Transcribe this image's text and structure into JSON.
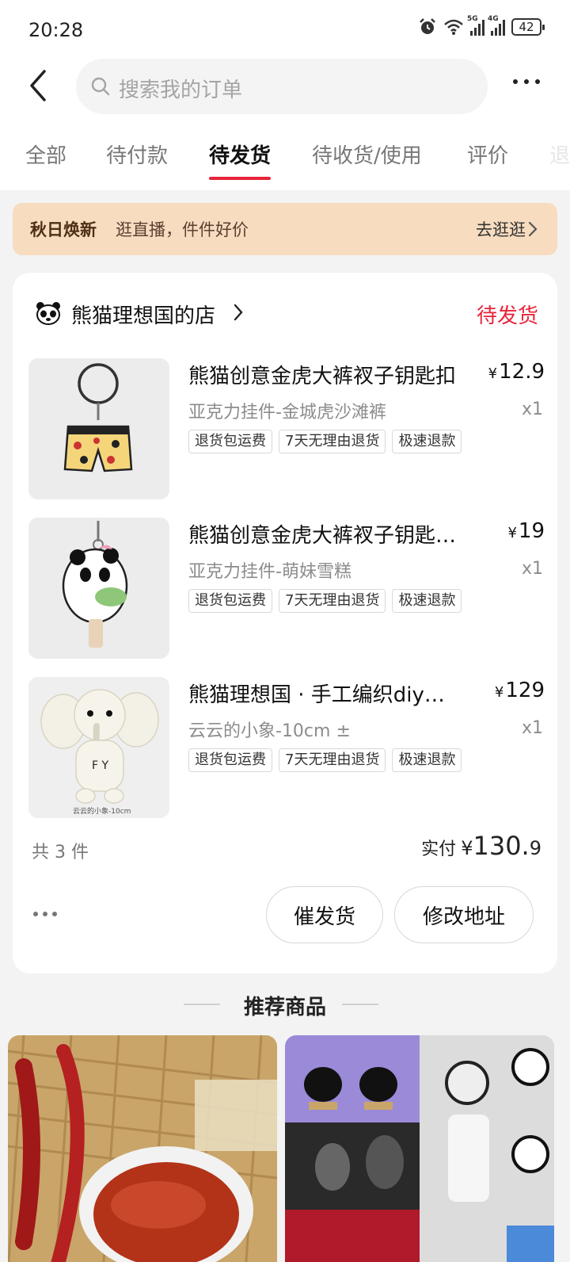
{
  "status_bar": {
    "time": "20:28",
    "battery": "42",
    "net1": "5G",
    "net2": "4G"
  },
  "header": {
    "search_placeholder": "搜索我的订单"
  },
  "tabs": [
    {
      "label": "全部"
    },
    {
      "label": "待付款"
    },
    {
      "label": "待发货",
      "active": true
    },
    {
      "label": "待收货/使用"
    },
    {
      "label": "评价"
    },
    {
      "label": "退"
    }
  ],
  "banner": {
    "title": "秋日焕新",
    "subtitle": "逛直播，件件好价",
    "action": "去逛逛"
  },
  "order": {
    "shop_name": "熊猫理想国的店",
    "status": "待发货",
    "items": [
      {
        "title": "熊猫创意金虎大裤衩子钥匙扣",
        "price": "12.9",
        "spec": "亚克力挂件-金城虎沙滩裤",
        "qty": "x1",
        "tags": [
          "退货包运费",
          "7天无理由退货",
          "极速退款"
        ]
      },
      {
        "title": "熊猫创意金虎大裤衩子钥匙扣挂件",
        "price": "19",
        "spec": "亚克力挂件-萌妹雪糕",
        "qty": "x1",
        "tags": [
          "退货包运费",
          "7天无理由退货",
          "极速退款"
        ]
      },
      {
        "title": "熊猫理想国 · 手工编织diy小象",
        "price": "129",
        "spec": "云云的小象-10cm ±",
        "qty": "x1",
        "tags": [
          "退货包运费",
          "7天无理由退货",
          "极速退款"
        ],
        "image_caption": "云云的小象-10cm"
      }
    ],
    "count_text": "共 3 件",
    "paid_label": "实付",
    "paid_currency": "¥",
    "paid_int": "130.",
    "paid_dec": "9",
    "buttons": {
      "urge": "催发货",
      "address": "修改地址"
    }
  },
  "recommend": {
    "title": "推荐商品"
  },
  "icons": [
    "back-arrow-icon",
    "search-icon",
    "more-dots-icon",
    "chevron-right-icon",
    "panda-shop-icon",
    "alarm-icon",
    "wifi-icon",
    "signal-icon",
    "battery-icon"
  ],
  "colors": {
    "accent": "#e8243b",
    "banner_bg": "#f7dcc0",
    "page_bg": "#f3f3f3"
  }
}
